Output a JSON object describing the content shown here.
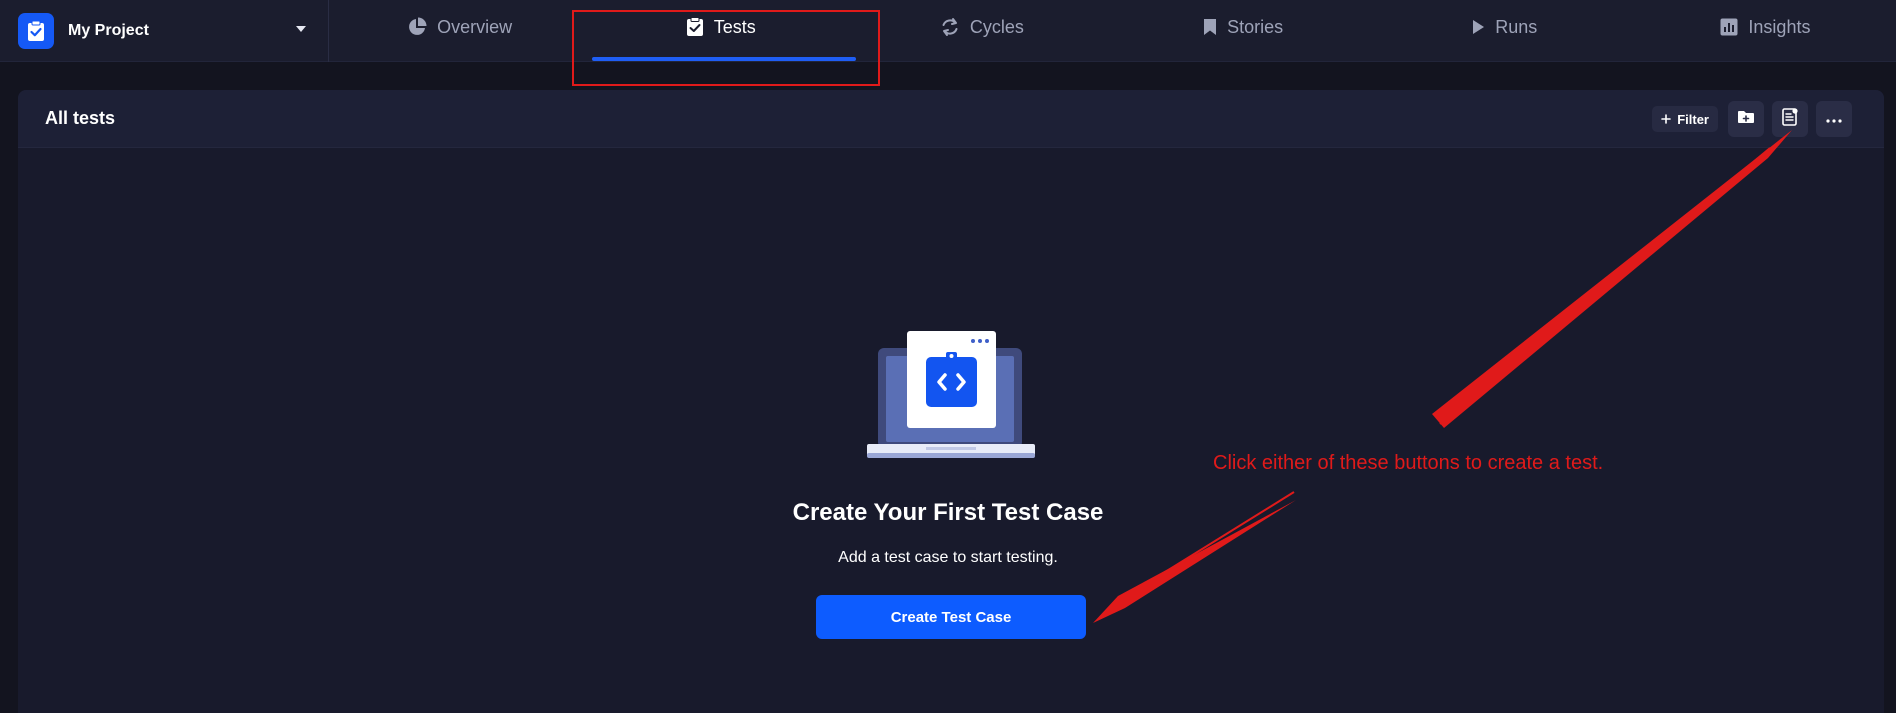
{
  "project": {
    "name": "My Project",
    "logo_icon": "clipboard-check-icon",
    "dropdown_icon": "caret-down-icon"
  },
  "tabs": [
    {
      "label": "Overview",
      "icon": "pie-chart-icon",
      "active": false
    },
    {
      "label": "Tests",
      "icon": "clipboard-check-icon",
      "active": true
    },
    {
      "label": "Cycles",
      "icon": "refresh-icon",
      "active": false
    },
    {
      "label": "Stories",
      "icon": "bookmark-icon",
      "active": false
    },
    {
      "label": "Runs",
      "icon": "play-icon",
      "active": false
    },
    {
      "label": "Insights",
      "icon": "bar-chart-icon",
      "active": false
    }
  ],
  "panel": {
    "title": "All tests",
    "filter_label": "Filter",
    "toolbar_icons": [
      "add-folder-icon",
      "add-test-icon",
      "more-icon"
    ]
  },
  "empty_state": {
    "title": "Create Your First Test Case",
    "subtitle": "Add a test case to start testing.",
    "button_label": "Create Test Case"
  },
  "annotation": {
    "text": "Click either of these buttons to create a test."
  },
  "colors": {
    "accent": "#0d5cff",
    "annotation": "#e01a1a",
    "background": "#13141f",
    "panel": "#181a2c"
  }
}
